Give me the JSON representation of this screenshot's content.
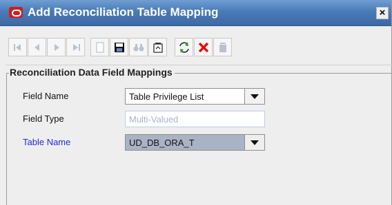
{
  "window": {
    "title": "Add Reconciliation Table Mapping",
    "close_label": "×"
  },
  "toolbar": {
    "buttons": [
      {
        "name": "first-record-icon",
        "enabled": false
      },
      {
        "name": "previous-record-icon",
        "enabled": false
      },
      {
        "name": "next-record-icon",
        "enabled": false
      },
      {
        "name": "last-record-icon",
        "enabled": false
      },
      {
        "name": "new-document-icon",
        "enabled": false
      },
      {
        "name": "save-disk-icon",
        "enabled": true
      },
      {
        "name": "binoculars-find-icon",
        "enabled": false
      },
      {
        "name": "clipboard-icon",
        "enabled": true
      },
      {
        "name": "refresh-arrows-icon",
        "enabled": true
      },
      {
        "name": "delete-x-icon",
        "enabled": true
      },
      {
        "name": "trash-can-icon",
        "enabled": false
      }
    ]
  },
  "panel": {
    "legend": "Reconciliation Data Field Mappings"
  },
  "form": {
    "field_name_label": "Field Name",
    "field_name_value": "Table Privilege List",
    "field_type_label": "Field Type",
    "field_type_value": "Multi-Valued",
    "table_name_label": "Table Name",
    "table_name_value": "UD_DB_ORA_T"
  },
  "colors": {
    "title_bar": "#4a7ab8",
    "required_label": "#1f2bd6",
    "delete_red": "#e01010"
  }
}
